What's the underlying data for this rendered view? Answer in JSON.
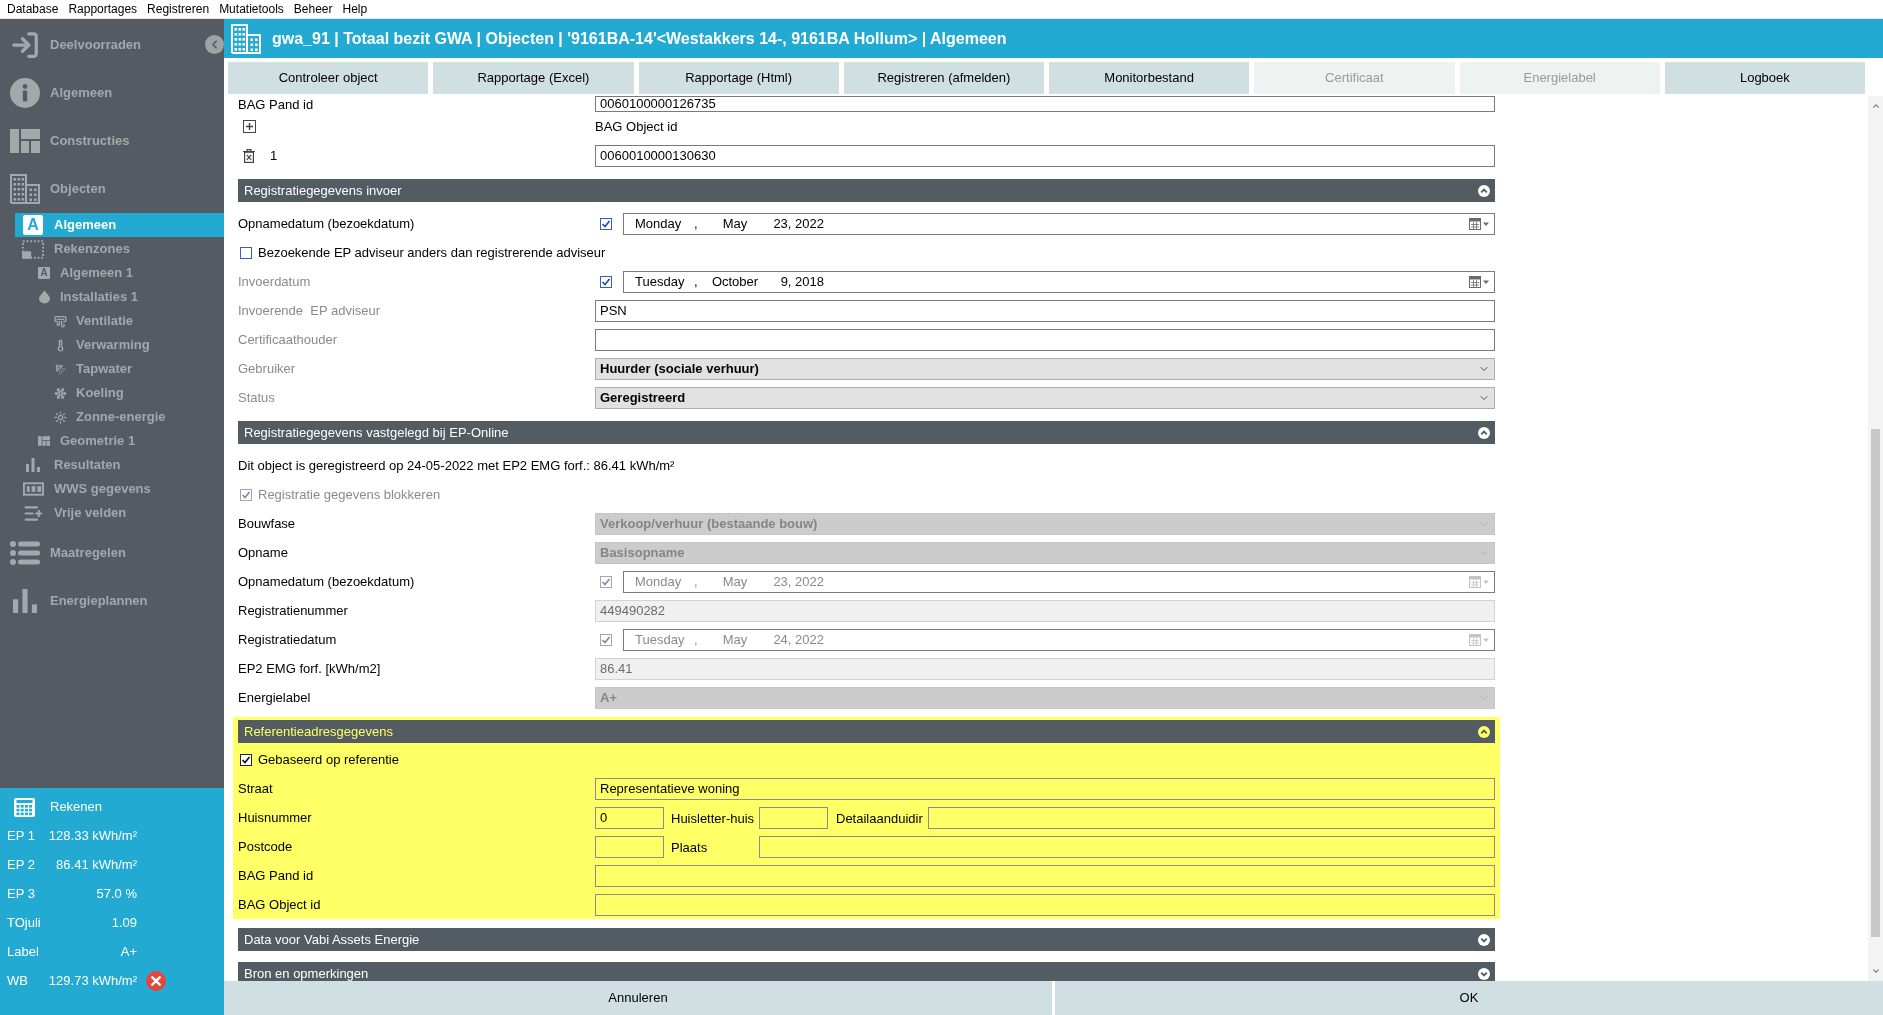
{
  "menu_bar": {
    "items": [
      "Database",
      "Rapportages",
      "Registreren",
      "Mutatietools",
      "Beheer",
      "Help"
    ]
  },
  "sidebar": {
    "items": [
      {
        "label": "Deelvoorraden",
        "selected": false
      },
      {
        "label": "Algemeen",
        "selected": false
      },
      {
        "label": "Constructies",
        "selected": false
      },
      {
        "label": "Objecten",
        "selected": false,
        "children": [
          {
            "label": "Algemeen",
            "icon_letter": "A",
            "selected": true
          },
          {
            "label": "Rekenzones",
            "selected": false,
            "children": [
              {
                "label": "Algemeen 1",
                "icon_letter": "A",
                "selected": false
              },
              {
                "label": "Installaties 1",
                "selected": false,
                "children": [
                  {
                    "label": "Ventilatie",
                    "selected": false
                  },
                  {
                    "label": "Verwarming",
                    "selected": false
                  },
                  {
                    "label": "Tapwater",
                    "selected": false
                  },
                  {
                    "label": "Koeling",
                    "selected": false
                  },
                  {
                    "label": "Zonne-energie",
                    "selected": false
                  }
                ]
              },
              {
                "label": "Geometrie 1",
                "selected": false
              }
            ]
          },
          {
            "label": "Resultaten",
            "selected": false
          },
          {
            "label": "WWS gegevens",
            "selected": false
          },
          {
            "label": "Vrije velden",
            "selected": false
          }
        ]
      },
      {
        "label": "Maatregelen",
        "selected": false
      },
      {
        "label": "Energieplannen",
        "selected": false
      }
    ]
  },
  "calc_panel": {
    "title": "Rekenen",
    "rows": [
      {
        "label": "EP 1",
        "value": "128.33 kWh/m²",
        "error": false
      },
      {
        "label": "EP 2",
        "value": "86.41 kWh/m²",
        "error": false
      },
      {
        "label": "EP 3",
        "value": "57.0 %",
        "error": false
      },
      {
        "label": "TOjuli",
        "value": "1.09",
        "error": false
      },
      {
        "label": "Label",
        "value": "A+",
        "error": false
      },
      {
        "label": "WB",
        "value": "129.73 kWh/m²",
        "error": true
      }
    ]
  },
  "window": {
    "title": "gwa_91 | Totaal bezit GWA | Objecten | '9161BA-14'<Westakkers 14-, 9161BA Hollum> | Algemeen"
  },
  "toolbar": {
    "buttons": [
      {
        "label": "Controleer object",
        "disabled": false
      },
      {
        "label": "Rapportage (Excel)",
        "disabled": false
      },
      {
        "label": "Rapportage (Html)",
        "disabled": false
      },
      {
        "label": "Registreren (afmelden)",
        "disabled": false
      },
      {
        "label": "Monitorbestand",
        "disabled": false
      },
      {
        "label": "Certificaat",
        "disabled": true
      },
      {
        "label": "Energielabel",
        "disabled": true
      },
      {
        "label": "Logboek",
        "disabled": false
      }
    ]
  },
  "form": {
    "top_rows": [
      {
        "kind": "field",
        "label": "BAG Pand id",
        "value": "0060100000126735"
      },
      {
        "kind": "add",
        "label": "BAG Object id"
      },
      {
        "kind": "entry",
        "index": "1",
        "value": "0060010000130630"
      }
    ],
    "sections": [
      {
        "title": "Registratiegegevens invoer",
        "expanded": true,
        "highlighted": false,
        "rows": [
          {
            "kind": "date",
            "label": "Opnamedatum (bezoekdatum)",
            "label_disabled": false,
            "checked": true,
            "disabled": false,
            "date": [
              "Monday",
              ",",
              "May",
              "23, 2022"
            ]
          },
          {
            "kind": "checkbox",
            "label": "Bezoekende EP adviseur anders dan registrerende adviseur",
            "checked": false,
            "disabled": false
          },
          {
            "kind": "date",
            "label": "Invoerdatum",
            "label_disabled": true,
            "checked": true,
            "disabled": false,
            "date": [
              "Tuesday",
              ",",
              "October",
              "9, 2018"
            ]
          },
          {
            "kind": "input",
            "label": "Invoerende  EP adviseur",
            "label_disabled": true,
            "value": "PSN",
            "disabled": false
          },
          {
            "kind": "input",
            "label": "Certificaathouder",
            "label_disabled": true,
            "disabled": false
          },
          {
            "kind": "select",
            "label": "Gebruiker",
            "label_disabled": true,
            "value": "Huurder (sociale verhuur)",
            "disabled": false
          },
          {
            "kind": "select",
            "label": "Status",
            "label_disabled": true,
            "value": "Geregistreerd",
            "disabled": false
          }
        ]
      },
      {
        "title": "Registratiegegevens vastgelegd bij EP-Online",
        "expanded": true,
        "highlighted": false,
        "rows": [
          {
            "kind": "text",
            "text": "Dit object is geregistreerd op 24-05-2022 met EP2 EMG forf.: 86.41 kWh/m²"
          },
          {
            "kind": "checkbox",
            "label": "Registratie gegevens blokkeren",
            "checked": true,
            "disabled": true
          },
          {
            "kind": "select",
            "label": "Bouwfase",
            "label_disabled": false,
            "value": "Verkoop/verhuur (bestaande bouw)",
            "disabled": true
          },
          {
            "kind": "select",
            "label": "Opname",
            "label_disabled": false,
            "value": "Basisopname",
            "disabled": true
          },
          {
            "kind": "date",
            "label": "Opnamedatum (bezoekdatum)",
            "label_disabled": false,
            "checked": true,
            "disabled": true,
            "date": [
              "Monday",
              ",",
              "May",
              "23, 2022"
            ]
          },
          {
            "kind": "input",
            "label": "Registratienummer",
            "label_disabled": false,
            "value": "449490282",
            "disabled": true
          },
          {
            "kind": "date",
            "label": "Registratiedatum",
            "label_disabled": false,
            "checked": true,
            "disabled": true,
            "date": [
              "Tuesday",
              ",",
              "May",
              "24, 2022"
            ]
          },
          {
            "kind": "input",
            "label": "EP2 EMG forf. [kWh/m2]",
            "label_disabled": false,
            "value": "86.41",
            "disabled": true
          },
          {
            "kind": "select",
            "label": "Energielabel",
            "label_disabled": false,
            "value": "A+",
            "disabled": true
          }
        ]
      },
      {
        "title": "Referentieadresgegevens",
        "expanded": true,
        "highlighted": true,
        "rows": [
          {
            "kind": "checkbox",
            "label": "Gebaseerd op referentie",
            "checked": true,
            "disabled": false
          },
          {
            "kind": "input",
            "label": "Straat",
            "label_disabled": false,
            "value": "Representatieve woning",
            "disabled": false
          },
          {
            "kind": "multi",
            "label": "Huisnummer",
            "label_disabled": false,
            "parts": [
              {
                "kind": "input",
                "value": "0"
              },
              {
                "kind": "label",
                "text": "Huisletter-huis"
              },
              {
                "kind": "input"
              },
              {
                "kind": "label",
                "text": "Detailaanduidir"
              },
              {
                "kind": "input"
              }
            ]
          },
          {
            "kind": "multi",
            "label": "Postcode",
            "label_disabled": false,
            "parts": [
              {
                "kind": "input"
              },
              {
                "kind": "label",
                "text": "Plaats"
              },
              {
                "kind": "input"
              }
            ]
          },
          {
            "kind": "input",
            "label": "BAG Pand id",
            "label_disabled": false,
            "disabled": false
          },
          {
            "kind": "input",
            "label": "BAG Object id",
            "label_disabled": false,
            "disabled": false
          }
        ]
      },
      {
        "title": "Data voor Vabi Assets Energie",
        "expanded": false,
        "highlighted": false
      },
      {
        "title": "Bron en opmerkingen",
        "expanded": false,
        "highlighted": false
      }
    ]
  },
  "footer": {
    "buttons": [
      "Annuleren",
      "OK"
    ]
  }
}
